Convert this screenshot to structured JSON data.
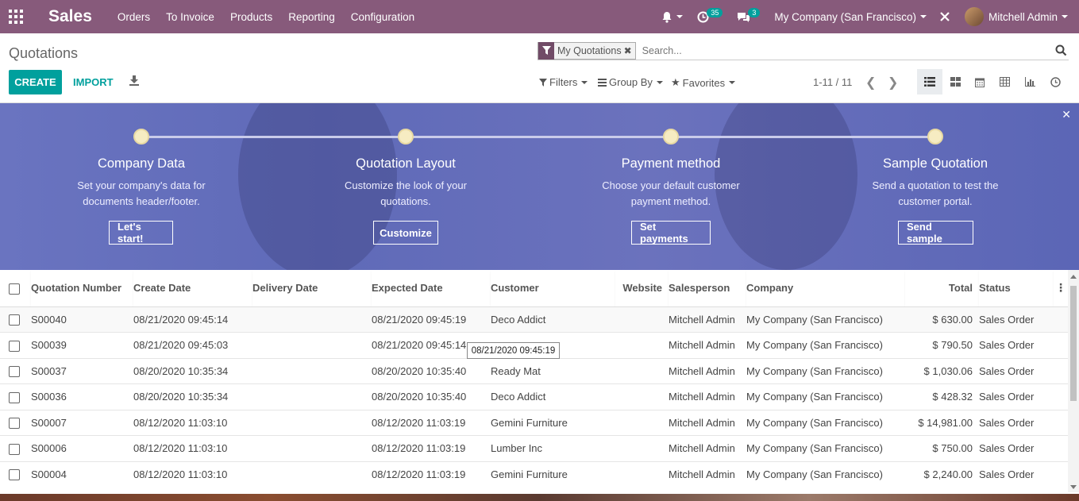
{
  "app": {
    "name": "Sales",
    "menu": [
      "Orders",
      "To Invoice",
      "Products",
      "Reporting",
      "Configuration"
    ],
    "activity_count": "35",
    "message_count": "3",
    "company": "My Company (San Francisco)",
    "user": "Mitchell Admin"
  },
  "control": {
    "breadcrumb": "Quotations",
    "create_label": "CREATE",
    "import_label": "IMPORT",
    "facet_label": "My Quotations",
    "search_placeholder": "Search...",
    "filters_label": "Filters",
    "groupby_label": "Group By",
    "favorites_label": "Favorites",
    "pager": "1-11 / 11"
  },
  "banner": {
    "steps": [
      {
        "title": "Company Data",
        "desc1": "Set your company's data for",
        "desc2": "documents header/footer.",
        "button": "Let's start!"
      },
      {
        "title": "Quotation Layout",
        "desc1": "Customize the look of your",
        "desc2": "quotations.",
        "button": "Customize"
      },
      {
        "title": "Payment method",
        "desc1": "Choose your default customer",
        "desc2": "payment method.",
        "button": "Set payments"
      },
      {
        "title": "Sample Quotation",
        "desc1": "Send a quotation to test the",
        "desc2": "customer portal.",
        "button": "Send sample"
      }
    ]
  },
  "table": {
    "columns": [
      "Quotation Number",
      "Create Date",
      "Delivery Date",
      "Expected Date",
      "Customer",
      "Website",
      "Salesperson",
      "Company",
      "Total",
      "Status"
    ],
    "rows": [
      {
        "number": "S00040",
        "create": "08/21/2020 09:45:14",
        "delivery": "",
        "expected": "08/21/2020 09:45:19",
        "customer": "Deco Addict",
        "website": "",
        "salesperson": "Mitchell Admin",
        "company": "My Company (San Francisco)",
        "total": "$ 630.00",
        "status": "Sales Order"
      },
      {
        "number": "S00039",
        "create": "08/21/2020 09:45:03",
        "delivery": "",
        "expected": "08/21/2020 09:45:14",
        "customer": "",
        "website": "",
        "salesperson": "Mitchell Admin",
        "company": "My Company (San Francisco)",
        "total": "$ 790.50",
        "status": "Sales Order"
      },
      {
        "number": "S00037",
        "create": "08/20/2020 10:35:34",
        "delivery": "",
        "expected": "08/20/2020 10:35:40",
        "customer": "Ready Mat",
        "website": "",
        "salesperson": "Mitchell Admin",
        "company": "My Company (San Francisco)",
        "total": "$ 1,030.06",
        "status": "Sales Order"
      },
      {
        "number": "S00036",
        "create": "08/20/2020 10:35:34",
        "delivery": "",
        "expected": "08/20/2020 10:35:40",
        "customer": "Deco Addict",
        "website": "",
        "salesperson": "Mitchell Admin",
        "company": "My Company (San Francisco)",
        "total": "$ 428.32",
        "status": "Sales Order"
      },
      {
        "number": "S00007",
        "create": "08/12/2020 11:03:10",
        "delivery": "",
        "expected": "08/12/2020 11:03:19",
        "customer": "Gemini Furniture",
        "website": "",
        "salesperson": "Mitchell Admin",
        "company": "My Company (San Francisco)",
        "total": "$ 14,981.00",
        "status": "Sales Order"
      },
      {
        "number": "S00006",
        "create": "08/12/2020 11:03:10",
        "delivery": "",
        "expected": "08/12/2020 11:03:19",
        "customer": "Lumber Inc",
        "website": "",
        "salesperson": "Mitchell Admin",
        "company": "My Company (San Francisco)",
        "total": "$ 750.00",
        "status": "Sales Order"
      },
      {
        "number": "S00004",
        "create": "08/12/2020 11:03:10",
        "delivery": "",
        "expected": "08/12/2020 11:03:19",
        "customer": "Gemini Furniture",
        "website": "",
        "salesperson": "Mitchell Admin",
        "company": "My Company (San Francisco)",
        "total": "$ 2,240.00",
        "status": "Sales Order"
      }
    ]
  },
  "tooltip": "08/21/2020 09:45:19",
  "colors": {
    "navbar": "#875a7b",
    "accent": "#00a09d",
    "banner": "#6a74c0"
  }
}
